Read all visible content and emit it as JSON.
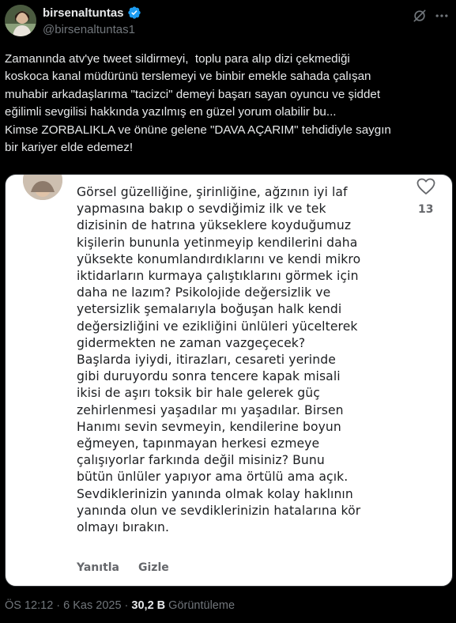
{
  "author": {
    "display_name": "birsenaltuntas",
    "handle": "@birsenaltuntas1",
    "verified_color": "#1d9bf0"
  },
  "tweet": {
    "text": "Zamanında atv'ye tweet sildirmeyi,  toplu para alıp dizi çekmediği\nkoskoca kanal müdürünü terslemeyi ve binbir emekle sahada çalışan\nmuhabir arkadaşlarıma \"tacizci\" demeyi başarı sayan oyuncu ve şiddet\neğilimli sevgilisi hakkında yazılmış en güzel yorum olabilir bu...\nKimse ZORBALIKLA ve önüne gelene \"DAVA AÇARIM\" tehdidiyle saygın\nbir kariyer elde edemez!"
  },
  "embedded_comment": {
    "text": "Görsel güzelliğine, şirinliğine, ağzının iyi laf\nyapmasına bakıp o sevdiğimiz ilk ve tek\ndizisinin de hatrına yükseklere koyduğumuz\nkişilerin bununla yetinmeyip kendilerini daha\nyüksekte konumlandırdıklarını ve kendi mikro\niktidarların kurmaya çalıştıklarını görmek için\ndaha ne lazım? Psikolojide değersizlik ve\nyetersizlik şemalarıyla boğuşan halk kendi\ndeğersizliğini ve ezikliğini ünlüleri yücelterek\ngidermekten ne zaman vazgeçecek?\nBaşlarda iyiydi, itirazları, cesareti yerinde\ngibi duruyordu sonra tencere kapak misali\nikisi de aşırı toksik bir hale gelerek güç\nzehirlenmesi yaşadılar mı yaşadılar. Birsen\nHanımı sevin sevmeyin, kendilerine boyun\neğmeyen, tapınmayan herkesi ezmeye\nçalışıyorlar farkında değil misiniz? Bunu\nbütün ünlüler yapıyor ama örtülü ama açık.\nSevdiklerinizin yanında olmak kolay haklının\nyanında olun ve sevdiklerinizin hatalarına kör\nolmayı bırakın.",
    "like_count": "13",
    "reply_label": "Yanıtla",
    "hide_label": "Gizle"
  },
  "meta": {
    "time": "ÖS 12:12",
    "separator1": " · ",
    "date": "6 Kas 2025",
    "separator2": " · ",
    "views_count": "30,2 B",
    "views_label": " Görüntüleme"
  },
  "icons": {
    "verified": "verified-badge-icon",
    "grok": "grok-icon",
    "more": "more-options-icon",
    "heart": "heart-icon"
  }
}
